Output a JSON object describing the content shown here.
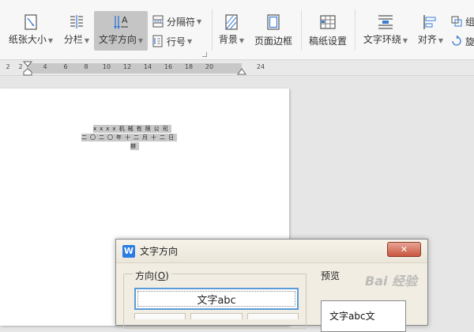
{
  "ribbon": {
    "paper_size": "纸张大小",
    "columns": "分栏",
    "text_direction": "文字方向",
    "separator": "分隔符",
    "line_number": "行号",
    "background": "背景",
    "page_border": "页面边框",
    "grid_paper": "稿纸设置",
    "text_wrap": "文字环绕",
    "align": "对齐",
    "cut_right_1": "组",
    "cut_right_2": "旋"
  },
  "ruler": {
    "numbers": [
      "2",
      "2",
      "4",
      "6",
      "8",
      "10",
      "12",
      "14",
      "16",
      "18",
      "20",
      "24"
    ]
  },
  "document": {
    "line1": "xxxx机械有限公司",
    "line2": "二〇二〇年十二月十二日",
    "line3": "赫"
  },
  "dialog": {
    "title": "文字方向",
    "close": "✕",
    "direction_label": "方向(",
    "direction_key": "O",
    "direction_suffix": ")",
    "option_horizontal": "文字abc",
    "preview_label": "预览",
    "preview_text": "文字abc文"
  },
  "watermark": "Bai 经验",
  "colors": {
    "accent": "#2b7be4",
    "close": "#c9553f",
    "selection": "#c9c9c9"
  }
}
